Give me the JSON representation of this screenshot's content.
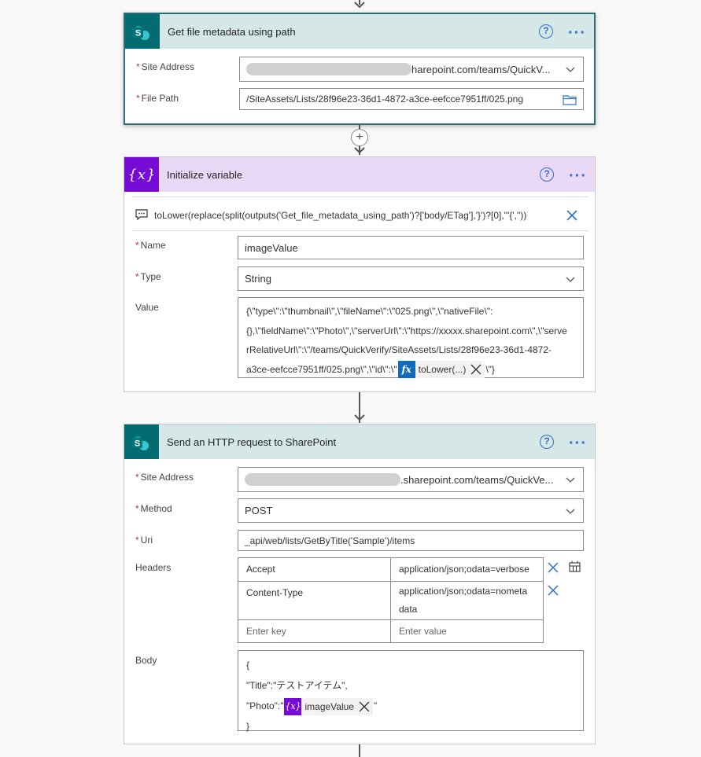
{
  "cards": {
    "metadata": {
      "title": "Get file metadata using path",
      "site_address_label": "Site Address",
      "site_address_value": "harepoint.com/teams/QuickV...",
      "file_path_label": "File Path",
      "file_path_value": "/SiteAssets/Lists/28f96e23-36d1-4872-a3ce-eefcce7951ff/025.png"
    },
    "init_variable": {
      "title": "Initialize variable",
      "expression_text": "toLower(replace(split(outputs('Get_file_metadata_using_path')?['body/ETag'],'}')?[0],'\"{',''))",
      "name_label": "Name",
      "name_value": "imageValue",
      "type_label": "Type",
      "type_value": "String",
      "value_label": "Value",
      "value_line1": "{\\\"type\\\":\\\"thumbnail\\\",\\\"fileName\\\":\\\"025.png\\\",\\\"nativeFile\\\":",
      "value_line2": "{},\\\"fieldName\\\":\\\"Photo\\\",\\\"serverUrl\\\":\\\"https://xxxxx.sharepoint.com\\\",\\\"serve",
      "value_line3": "rRelativeUrl\\\":\\\"/teams/QuickVerify/SiteAssets/Lists/28f96e23-36d1-4872-",
      "value_line4_prefix": "a3ce-eefcce7951ff/025.png\\\",\\\"id\\\":\\\"",
      "value_token_label": "toLower(...)",
      "value_line4_suffix": "\\\"}"
    },
    "http_request": {
      "title": "Send an HTTP request to SharePoint",
      "site_address_label": "Site Address",
      "site_address_value": ".sharepoint.com/teams/QuickVe...",
      "method_label": "Method",
      "method_value": "POST",
      "uri_label": "Uri",
      "uri_value": "_api/web/lists/GetByTitle('Sample')/items",
      "headers_label": "Headers",
      "headers": [
        {
          "key": "Accept",
          "value": "application/json;odata=verbose"
        },
        {
          "key": "Content-Type",
          "value": "application/json;odata=nometa data"
        }
      ],
      "key_placeholder": "Enter key",
      "value_placeholder": "Enter value",
      "body_label": "Body",
      "body_line1": "{",
      "body_line2": "\"Title\":\"テストアイテム\",",
      "body_line3_prefix": "\"Photo\":\"",
      "body_token_label": "imageValue",
      "body_line3_suffix": "\"",
      "body_line4": "}"
    }
  },
  "icons": {
    "help": "help-icon",
    "more": "more-icon",
    "sharepoint": "sharepoint-icon",
    "variable": "variable-icon"
  },
  "colors": {
    "sharepoint_header": "#d6e7e7",
    "sharepoint_icon": "#036c70",
    "variable_header": "#e9d8f6",
    "variable_icon": "#770bd6",
    "accent": "#2f6fcf",
    "fx_token": "#0f6cbd"
  }
}
